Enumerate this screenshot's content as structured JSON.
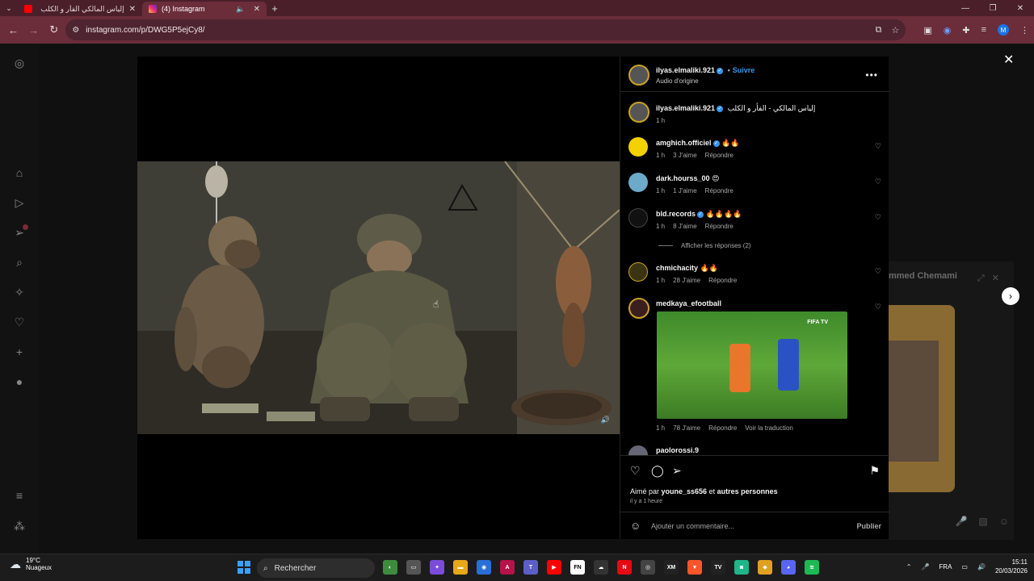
{
  "browser": {
    "tabs": [
      {
        "title": "إلياس المالكي الفأر و الكلب",
        "active": false
      },
      {
        "title": "(4) Instagram",
        "active": true
      }
    ],
    "url": "instagram.com/p/DWG5P5ejCy8/",
    "profile_initial": "M"
  },
  "post": {
    "author": "ilyas.elmaliki.921",
    "follow_sep": "•",
    "follow_label": "Suivre",
    "audio": "Audio d'origine",
    "caption_user": "ilyas.elmaliki.921",
    "caption_text": "إلياس المالكي - الفأر و الكلب",
    "caption_time": "1 h",
    "comments": [
      {
        "user": "amghich.officiel",
        "text": "🔥🔥",
        "time": "1 h",
        "likes": "3 J'aime",
        "reply": "Répondre"
      },
      {
        "user": "dark.hourss_00",
        "text": "😍",
        "time": "1 h",
        "likes": "1 J'aime",
        "reply": "Répondre"
      },
      {
        "user": "bld.records",
        "text": "🔥🔥🔥🔥",
        "time": "1 h",
        "likes": "8 J'aime",
        "reply": "Répondre"
      },
      {
        "user": "chmichacity",
        "text": "🔥🔥",
        "time": "1 h",
        "likes": "28 J'aime",
        "reply": "Répondre"
      },
      {
        "user": "medkaya_efootball",
        "text": "",
        "time": "1 h",
        "likes": "78 J'aime",
        "reply": "Répondre",
        "translate": "Voir la traduction"
      },
      {
        "user": "paolorossi.9",
        "text": ""
      }
    ],
    "show_replies": "Afficher les réponses (2)",
    "gif_logo": "FIFA TV",
    "liked_prefix": "Aimé par",
    "liked_user": "youne_ss656",
    "liked_and": "et",
    "liked_others": "autres personnes",
    "posted_ago": "il y a 1 heure",
    "comment_placeholder": "Ajouter un commentaire...",
    "publish": "Publier"
  },
  "dm_widget": {
    "name": "mmed Chemami"
  },
  "taskbar": {
    "temp": "19°C",
    "condition": "Nuageux",
    "search": "Rechercher",
    "lang": "FRA",
    "time": "15:11",
    "date": "20/03/2026"
  },
  "colors": {
    "accent": "#3897f0",
    "chrome": "#6b2d3a",
    "tabbar": "#4a1f2a"
  }
}
